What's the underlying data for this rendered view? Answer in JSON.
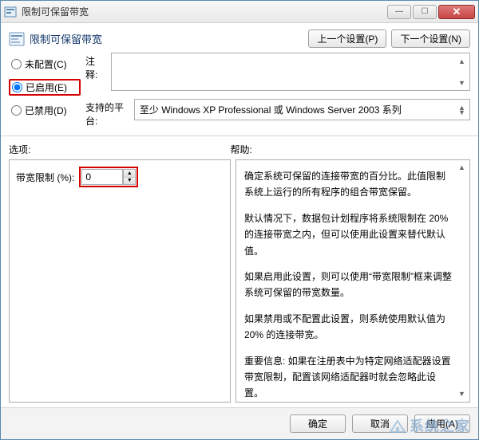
{
  "window": {
    "title": "限制可保留带宽"
  },
  "header": {
    "title": "限制可保留带宽",
    "prev_button": "上一个设置(P)",
    "next_button": "下一个设置(N)"
  },
  "config": {
    "radio_not_configured": "未配置(C)",
    "radio_enabled": "已启用(E)",
    "radio_disabled": "已禁用(D)",
    "selected": "enabled",
    "comment_label": "注释:",
    "comment_value": "",
    "platform_label": "支持的平台:",
    "platform_value": "至少 Windows XP Professional 或 Windows Server 2003 系列"
  },
  "section_labels": {
    "options": "选项:",
    "help": "帮助:"
  },
  "options": {
    "bandwidth_label": "带宽限制 (%):",
    "bandwidth_value": "0"
  },
  "help": {
    "p1": "确定系统可保留的连接带宽的百分比。此值限制系统上运行的所有程序的组合带宽保留。",
    "p2": "默认情况下，数据包计划程序将系统限制在 20% 的连接带宽之内，但可以使用此设置来替代默认值。",
    "p3": "如果启用此设置，则可以使用“带宽限制”框来调整系统可保留的带宽数量。",
    "p4": "如果禁用或不配置此设置，则系统使用默认值为 20% 的连接带宽。",
    "p5": "重要信息: 如果在注册表中为特定网络适配器设置带宽限制，配置该网络适配器时就会忽略此设置。"
  },
  "footer": {
    "ok": "确定",
    "cancel": "取消",
    "apply": "应用(A)"
  },
  "watermark": "系统之家"
}
